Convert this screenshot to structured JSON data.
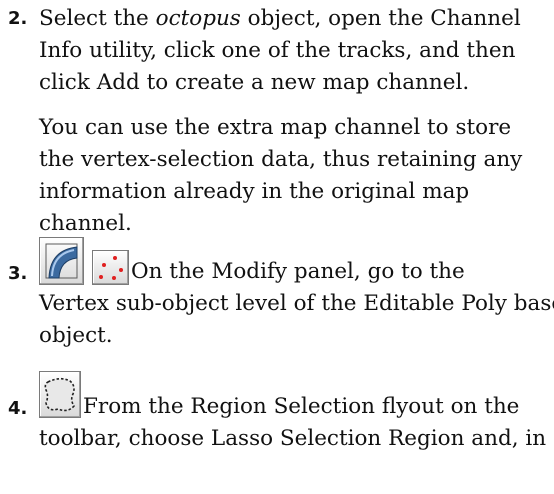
{
  "steps": [
    {
      "number": "2.",
      "lines": [
        {
          "before": "Select the ",
          "italic": "octopus",
          "after": " object, open the Channel"
        },
        "Info utility, click one of the tracks, and then",
        "click Add to create a new map channel."
      ],
      "note_lines": [
        "You can use the extra map channel to store",
        "the vertex-selection data, thus retaining any",
        "information already in the original map",
        "channel."
      ]
    },
    {
      "number": "3.",
      "icons": [
        "editable-poly-icon",
        "vertex-subobject-icon"
      ],
      "lines": [
        "On the Modify panel, go to the",
        "Vertex sub-object level of the Editable Poly base",
        "object."
      ]
    },
    {
      "number": "4.",
      "icons": [
        "lasso-selection-region-icon"
      ],
      "lines": [
        "From the Region Selection flyout on the",
        "toolbar, choose Lasso Selection Region and, in"
      ]
    }
  ],
  "colors": {
    "text": "#111111",
    "vertex_dot": "#e02020",
    "icon_blue": "#3b6aa0"
  }
}
